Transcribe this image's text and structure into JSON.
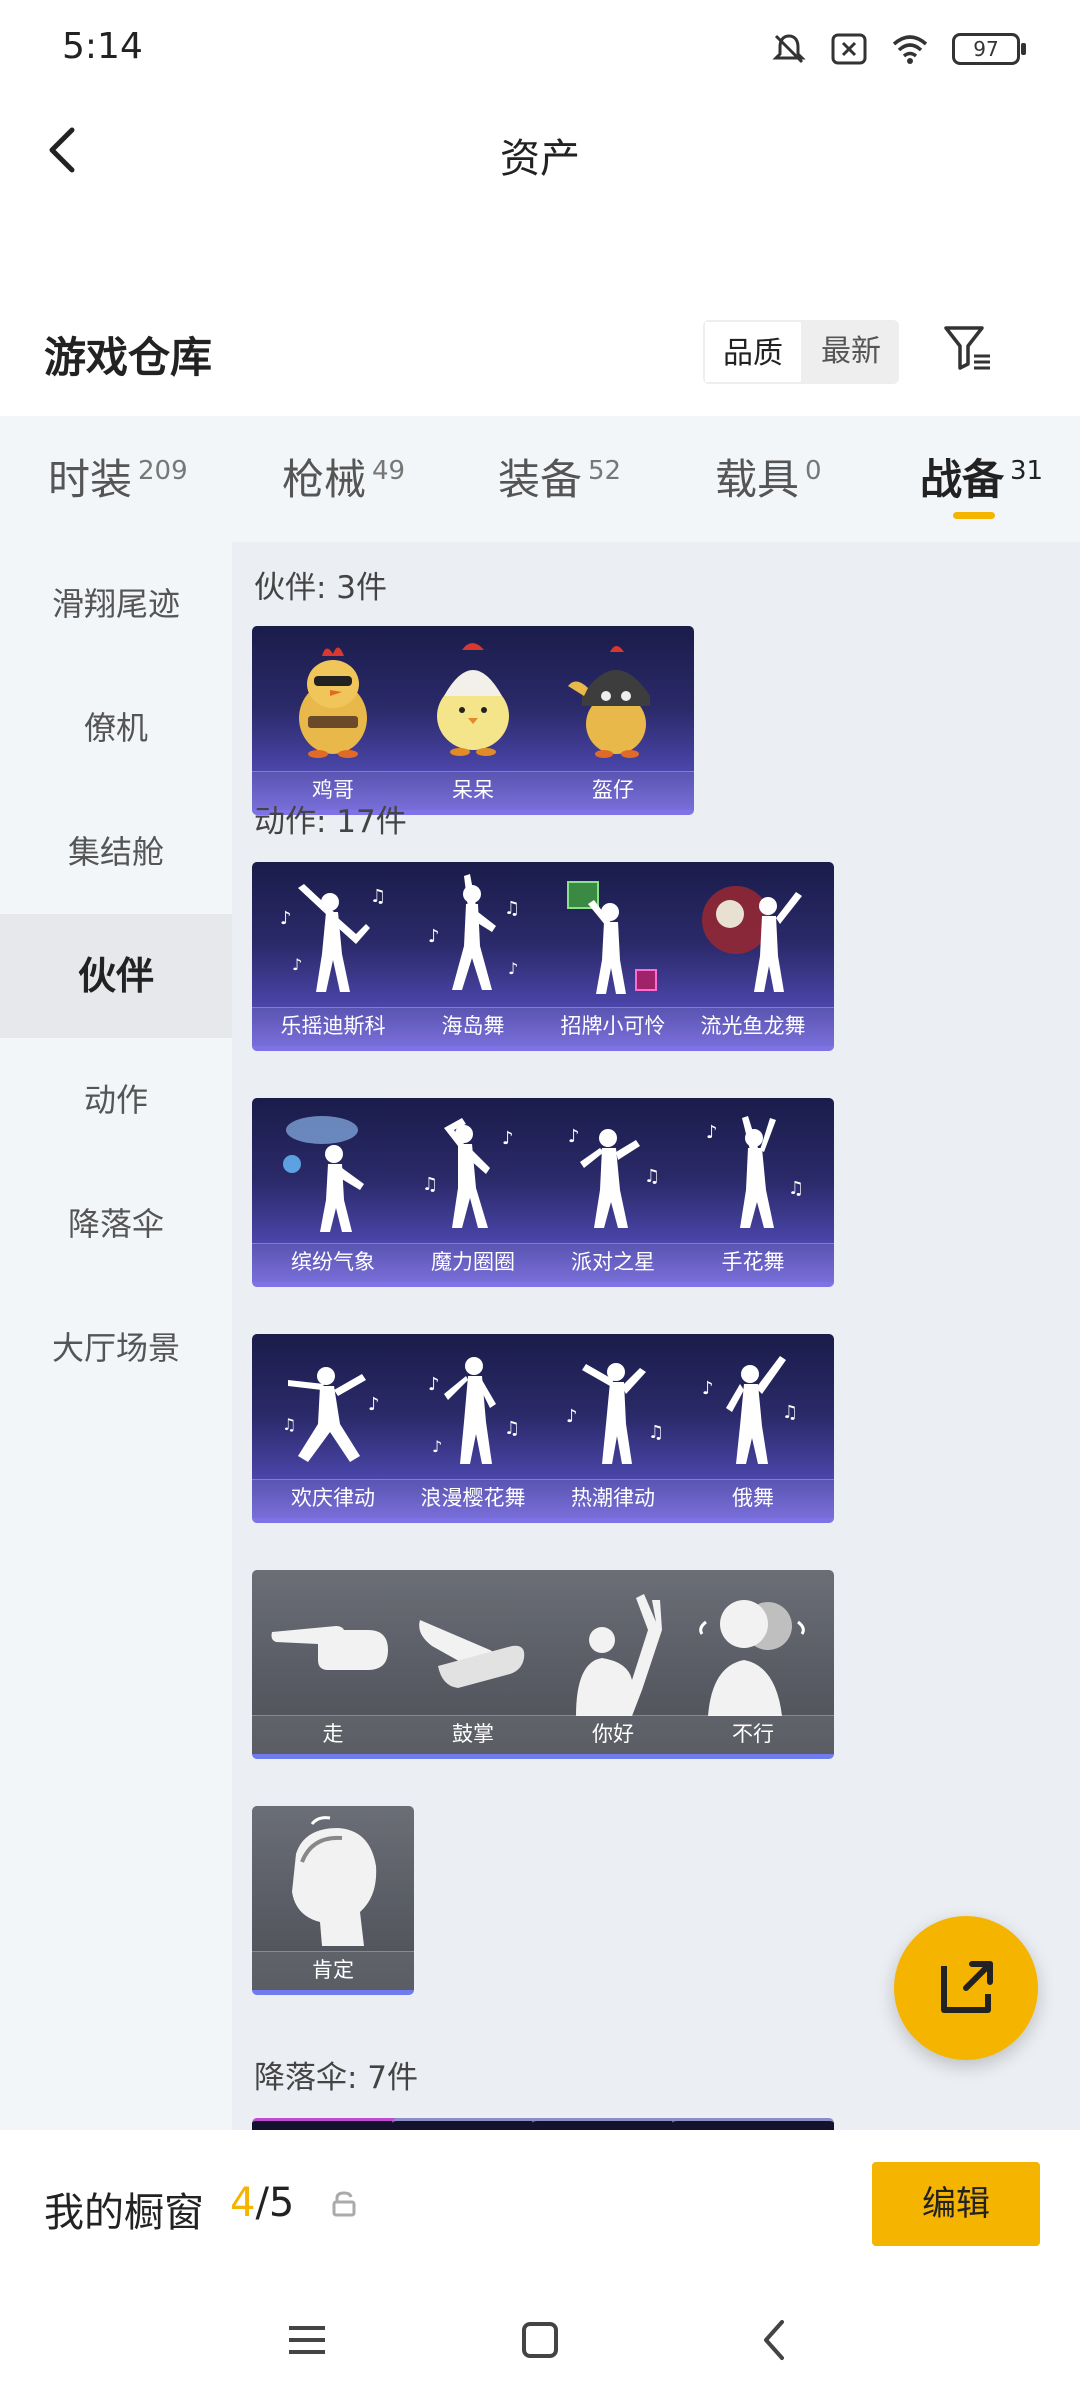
{
  "status": {
    "time": "5:14",
    "battery": "97"
  },
  "header": {
    "title": "资产"
  },
  "warehouse": {
    "title": "游戏仓库",
    "sort_options": [
      "品质",
      "最新"
    ]
  },
  "categories": [
    {
      "label": "时装",
      "count": "209"
    },
    {
      "label": "枪械",
      "count": "49"
    },
    {
      "label": "装备",
      "count": "52"
    },
    {
      "label": "载具",
      "count": "0"
    },
    {
      "label": "战备",
      "count": "31"
    }
  ],
  "sidebar": {
    "items": [
      "滑翔尾迹",
      "僚机",
      "集结舱",
      "伙伴",
      "动作",
      "降落伞",
      "大厅场景"
    ]
  },
  "sections": {
    "partners": {
      "title": "伙伴: 3件",
      "items": [
        "鸡哥",
        "呆呆",
        "盔仔"
      ]
    },
    "actions": {
      "title": "动作: 17件",
      "items": [
        "乐摇迪斯科",
        "海岛舞",
        "招牌小可怜",
        "流光鱼龙舞",
        "缤纷气象",
        "魔力圈圈",
        "派对之星",
        "手花舞",
        "欢庆律动",
        "浪漫樱花舞",
        "热潮律动",
        "俄舞",
        "走",
        "鼓掌",
        "你好",
        "不行",
        "肯定"
      ]
    },
    "parachutes": {
      "title": "降落伞: 7件"
    }
  },
  "showcase": {
    "label": "我的橱窗",
    "current": "4",
    "total": "/5",
    "edit_label": "编辑"
  },
  "colors": {
    "accent": "#f5b400",
    "card_purple": "#4a45a8",
    "card_gray": "#585b63"
  }
}
